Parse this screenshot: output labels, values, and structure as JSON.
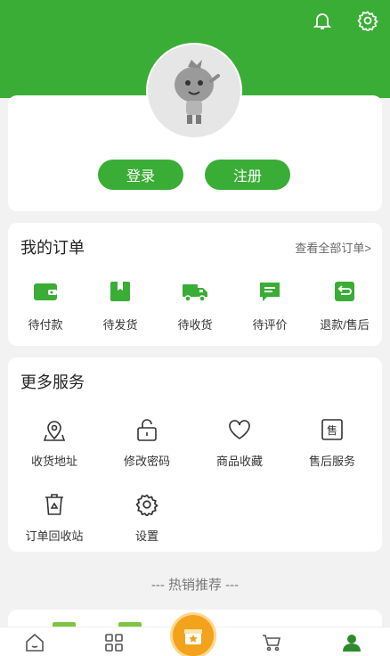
{
  "header": {
    "bell_icon": "bell-icon",
    "settings_icon": "gear-icon",
    "brand_color": "#3aad36"
  },
  "profile": {
    "avatar_icon": "mascot-avatar",
    "login_label": "登录",
    "register_label": "注册"
  },
  "orders": {
    "title": "我的订单",
    "view_all": "查看全部订单>",
    "items": [
      {
        "label": "待付款",
        "icon": "wallet-icon"
      },
      {
        "label": "待发货",
        "icon": "package-icon"
      },
      {
        "label": "待收货",
        "icon": "truck-icon"
      },
      {
        "label": "待评价",
        "icon": "comment-icon"
      },
      {
        "label": "退款/售后",
        "icon": "refund-icon"
      }
    ]
  },
  "services": {
    "title": "更多服务",
    "items": [
      {
        "label": "收货地址",
        "icon": "location-icon"
      },
      {
        "label": "修改密码",
        "icon": "lock-icon"
      },
      {
        "label": "商品收藏",
        "icon": "heart-icon"
      },
      {
        "label": "售后服务",
        "icon": "after-sale-icon"
      },
      {
        "label": "订单回收站",
        "icon": "recycle-bin-icon"
      },
      {
        "label": "设置",
        "icon": "settings-icon"
      }
    ]
  },
  "hot": {
    "title": "--- 热销推荐 ---"
  },
  "tabbar": {
    "items": [
      "home-icon",
      "category-icon",
      "gift-icon",
      "cart-icon",
      "user-icon"
    ],
    "active": "user-icon"
  }
}
